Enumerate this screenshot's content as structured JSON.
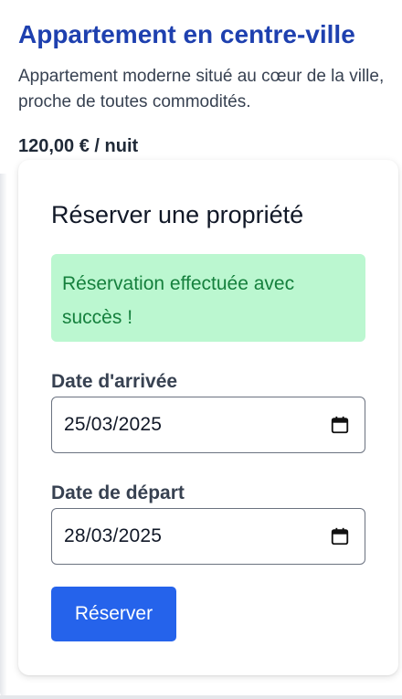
{
  "listing": {
    "title": "Appartement en centre-ville",
    "description": "Appartement moderne situé au cœur de la ville, proche de toutes commodités.",
    "price": "120,00 € / nuit"
  },
  "booking": {
    "title": "Réserver une propriété",
    "success_message": "Réservation effectuée avec succès !",
    "arrival_label": "Date d'arrivée",
    "arrival_value": "25/03/2025",
    "departure_label": "Date de départ",
    "departure_value": "28/03/2025",
    "submit_label": "Réserver"
  },
  "colors": {
    "title": "#1e40af",
    "success_bg": "#bbf7d0",
    "success_text": "#15803d",
    "primary_button": "#2563eb"
  },
  "icons": {
    "date_picker": "calendar-icon"
  }
}
